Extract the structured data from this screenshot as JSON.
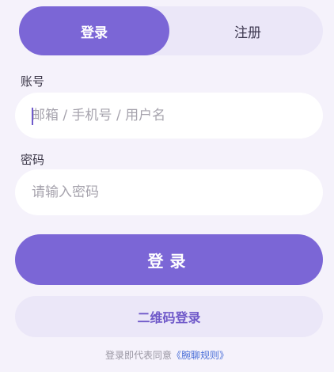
{
  "tabs": {
    "login_label": "登录",
    "register_label": "注册",
    "active": "login"
  },
  "account": {
    "label": "账号",
    "placeholder": "邮箱 / 手机号 / 用户名",
    "value": ""
  },
  "password": {
    "label": "密码",
    "placeholder": "请输入密码",
    "value": ""
  },
  "login_button": {
    "label": "登录"
  },
  "qr_button": {
    "label": "二维码登录"
  },
  "agreement": {
    "text": "登录即代表同意",
    "link": "《腕聊规则》"
  },
  "colors": {
    "accent": "#7b66d6",
    "background": "#f5f2fb",
    "soft": "#ebe7f8",
    "link": "#4a6fd8"
  }
}
